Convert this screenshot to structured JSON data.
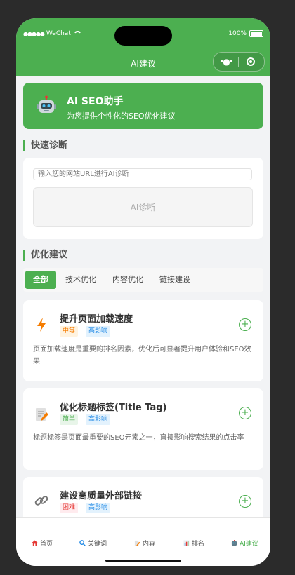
{
  "statusbar": {
    "carrier": "WeChat",
    "battery": "100%"
  },
  "navbar": {
    "title": "AI建议"
  },
  "hero": {
    "title": "AI SEO助手",
    "subtitle": "为您提供个性化的SEO优化建议"
  },
  "diagnosis": {
    "section_title": "快速诊断",
    "input_placeholder": "输入您的网站URL进行AI诊断",
    "button_label": "AI诊断"
  },
  "suggestions": {
    "section_title": "优化建议",
    "tabs": [
      {
        "label": "全部",
        "active": true
      },
      {
        "label": "技术优化",
        "active": false
      },
      {
        "label": "内容优化",
        "active": false
      },
      {
        "label": "链接建设",
        "active": false
      }
    ],
    "items": [
      {
        "icon": "lightning-icon",
        "title": "提升页面加载速度",
        "difficulty": "中等",
        "impact": "高影响",
        "description": "页面加载速度是重要的排名因素，优化后可显著提升用户体验和SEO效果"
      },
      {
        "icon": "memo-icon",
        "title": "优化标题标签(Title Tag)",
        "difficulty": "简单",
        "impact": "高影响",
        "description": "标题标签是页面最重要的SEO元素之一，直接影响搜索结果的点击率"
      },
      {
        "icon": "link-icon",
        "title": "建设高质量外部链接",
        "difficulty": "困难",
        "impact": "高影响",
        "description": ""
      }
    ]
  },
  "tabbar": {
    "items": [
      {
        "label": "首页",
        "icon": "house-icon"
      },
      {
        "label": "关键词",
        "icon": "magnifier-icon"
      },
      {
        "label": "内容",
        "icon": "memo-icon"
      },
      {
        "label": "排名",
        "icon": "bar-chart-icon"
      },
      {
        "label": "AI建议",
        "icon": "robot-icon",
        "active": true
      }
    ]
  },
  "colors": {
    "primary": "#4caf50",
    "background": "#f2f3f5"
  }
}
